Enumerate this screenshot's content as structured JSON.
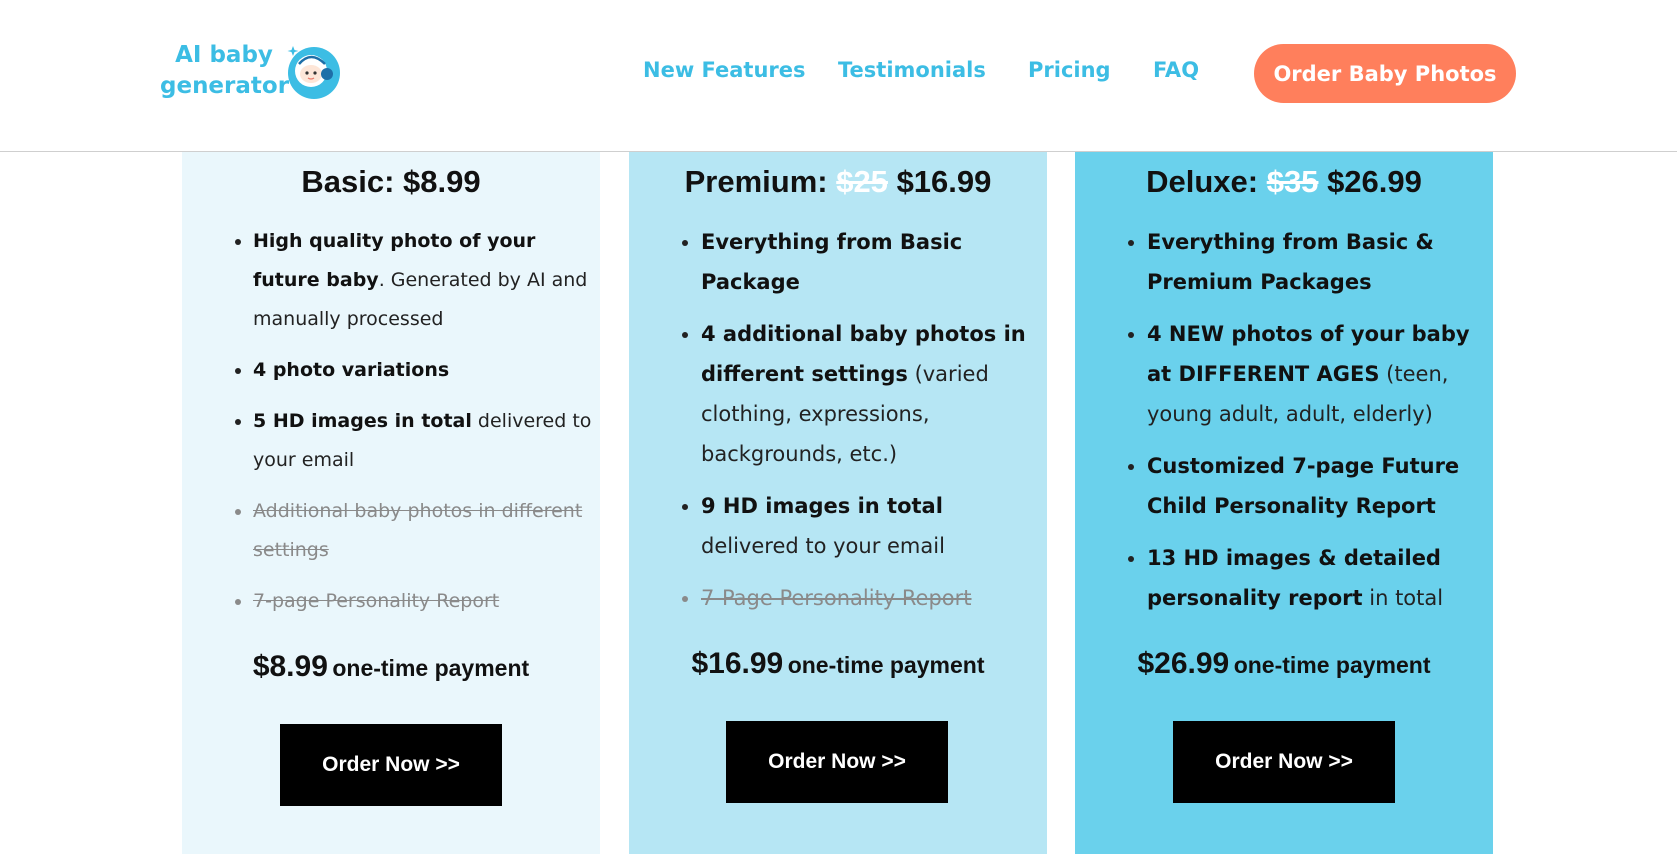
{
  "header": {
    "logo_text": "AI baby generator",
    "nav": [
      {
        "label": "New Features"
      },
      {
        "label": "Testimonials"
      },
      {
        "label": "Pricing"
      },
      {
        "label": "FAQ"
      }
    ],
    "cta_label": "Order Baby Photos"
  },
  "colors": {
    "accent": "#3cbde4",
    "cta": "#ff7f5c",
    "basic_bg": "#eaf7fc",
    "premium_bg": "#b6e6f4",
    "deluxe_bg": "#6ad1ec"
  },
  "plans": [
    {
      "name": "Basic:",
      "old_price": "",
      "price": "$8.99",
      "features": [
        {
          "bold": "High quality photo of your future baby",
          "rest": ". Generated by AI and manually processed",
          "disabled": false
        },
        {
          "bold": "4 photo variations",
          "rest": "",
          "disabled": false
        },
        {
          "bold": "5 HD images in total",
          "rest": " delivered to your email",
          "disabled": false
        },
        {
          "bold": "",
          "rest": "Additional baby photos in different settings",
          "disabled": true
        },
        {
          "bold": "",
          "rest": "7-page Personality Report",
          "disabled": true
        }
      ],
      "payment_amount": "$8.99",
      "payment_label": "one-time payment",
      "button_label": "Order Now >>"
    },
    {
      "name": "Premium:",
      "old_price": "$25",
      "price": "$16.99",
      "features": [
        {
          "bold": "Everything from Basic Package",
          "rest": "",
          "disabled": false
        },
        {
          "bold": "4 additional baby photos in different settings",
          "rest": " (varied clothing, expressions, backgrounds, etc.)",
          "disabled": false
        },
        {
          "bold": "9 HD images in total",
          "rest": " delivered to your email",
          "disabled": false
        },
        {
          "bold": "",
          "rest": "7-Page Personality Report",
          "disabled": true
        }
      ],
      "payment_amount": "$16.99",
      "payment_label": "one-time payment",
      "button_label": "Order Now >>"
    },
    {
      "name": "Deluxe:",
      "old_price": "$35",
      "price": "$26.99",
      "features": [
        {
          "bold": "Everything from Basic & Premium Packages",
          "rest": "",
          "disabled": false
        },
        {
          "bold": "4 NEW photos of your baby at DIFFERENT AGES",
          "rest": " (teen, young adult, adult, elderly)",
          "disabled": false
        },
        {
          "bold": "Customized 7-page Future Child Personality Report",
          "rest": "",
          "disabled": false
        },
        {
          "bold": "13 HD images & detailed personality report",
          "rest": " in total",
          "disabled": false
        }
      ],
      "payment_amount": "$26.99",
      "payment_label": "one-time payment",
      "button_label": "Order Now >>"
    }
  ]
}
